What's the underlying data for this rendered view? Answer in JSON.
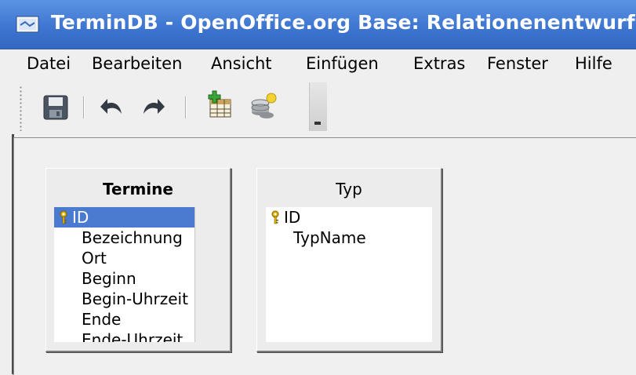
{
  "window": {
    "title": "TerminDB - OpenOffice.org Base: Relationenentwurf"
  },
  "menubar": {
    "items": [
      "Datei",
      "Bearbeiten",
      "Ansicht",
      "Einfügen",
      "Extras",
      "Fenster",
      "Hilfe"
    ]
  },
  "toolbar": {
    "icons": [
      "save-icon",
      "undo-icon",
      "redo-icon",
      "add-table-icon",
      "new-relation-icon",
      "toolbar-dropdown-icon"
    ]
  },
  "tables": [
    {
      "name": "Termine",
      "fields": [
        {
          "name": "ID",
          "primary_key": true,
          "selected": true
        },
        {
          "name": "Bezeichnung"
        },
        {
          "name": "Ort"
        },
        {
          "name": "Beginn"
        },
        {
          "name": "Begin-Uhrzeit"
        },
        {
          "name": "Ende"
        },
        {
          "name": "Ende-Uhrzeit"
        }
      ]
    },
    {
      "name": "Typ",
      "fields": [
        {
          "name": "ID",
          "primary_key": true
        },
        {
          "name": "TypName"
        }
      ]
    }
  ],
  "colors": {
    "titlebar": "#3c74cf",
    "selection": "#4a7bd0"
  }
}
